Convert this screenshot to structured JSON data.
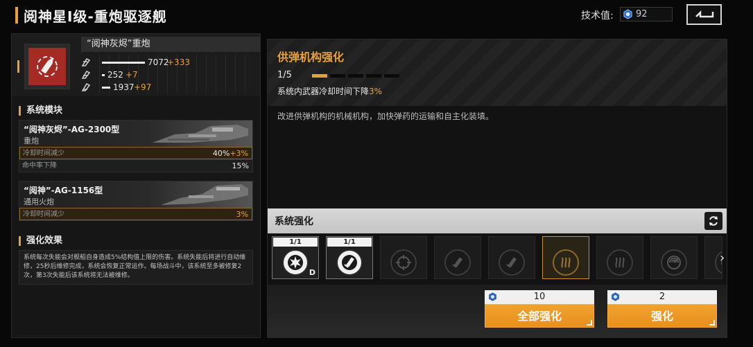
{
  "header": {
    "title": "阅神星I级-重炮驱逐舰",
    "tech_label": "技术值:",
    "tech_value": "92",
    "back_icon": "back-icon"
  },
  "weapon": {
    "name": "“阅神灰烬”重炮",
    "stats": [
      {
        "icon": "damage-icon",
        "value": "7072",
        "add": "+333"
      },
      {
        "icon": "penetration-icon",
        "value": "252",
        "add": "+7"
      },
      {
        "icon": "range-icon",
        "value": "1937",
        "add": "+97"
      }
    ]
  },
  "modules": {
    "heading": "系统模块",
    "items": [
      {
        "name": "“阅神灰烬”-AG-2300型",
        "type": "重炮",
        "rows": [
          {
            "label": "冷却时间减少",
            "value": "40%",
            "add": "+3%",
            "highlight": true
          },
          {
            "label": "命中率下降",
            "value": "15%",
            "add": "",
            "highlight": false
          }
        ]
      },
      {
        "name": "“阅神”-AG-1156型",
        "type": "通用火炮",
        "rows": [
          {
            "label": "冷却时间减少",
            "value": "3%",
            "add": "",
            "highlight": true
          }
        ]
      }
    ]
  },
  "effect": {
    "heading": "强化效果",
    "text": "系统每次失能会对舰船自身造成5%结构值上限的伤害。系统失能后将进行自动维修，25秒后维修完成，系统会恢复正常运作。每场战斗中，该系统至多被修复2次，第3次失能后该系统将无法被维修。"
  },
  "upgrade": {
    "title": "供弹机构强化",
    "level": "1/5",
    "level_current": 1,
    "level_max": 5,
    "effect_prefix": "系统内武器冷却时间下降",
    "effect_value": "3%",
    "description": "改进供弹机构的机械机构，加快弹药的运输和自主化装填。"
  },
  "system": {
    "heading": "系统强化",
    "refresh_icon": "refresh-icon",
    "slots": [
      {
        "count": "1/1",
        "icon": "burst-icon",
        "state": "unlocked",
        "badge": "D"
      },
      {
        "count": "1/1",
        "icon": "shell-loader-icon",
        "state": "unlocked",
        "badge": ""
      },
      {
        "count": "",
        "icon": "targeting-icon",
        "state": "locked",
        "badge": ""
      },
      {
        "count": "",
        "icon": "shell-loader-icon",
        "state": "locked",
        "badge": ""
      },
      {
        "count": "",
        "icon": "shell-loader-icon",
        "state": "locked",
        "badge": ""
      },
      {
        "count": "",
        "icon": "heat-icon",
        "state": "selected",
        "badge": ""
      },
      {
        "count": "",
        "icon": "heat-icon",
        "state": "locked",
        "badge": ""
      },
      {
        "count": "",
        "icon": "radar-icon",
        "state": "locked",
        "badge": ""
      },
      {
        "count": "",
        "icon": "radar-icon",
        "state": "locked",
        "badge": ""
      }
    ],
    "next_label": "›"
  },
  "actions": {
    "upgrade_all": {
      "cost": "10",
      "label": "全部强化"
    },
    "upgrade": {
      "cost": "2",
      "label": "强化"
    }
  },
  "colors": {
    "accent": "#e8a13a",
    "weapon_bg": "#a62a24"
  }
}
